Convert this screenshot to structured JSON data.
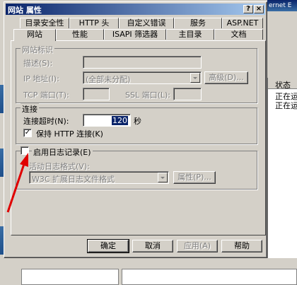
{
  "background": {
    "title_fragment": "ernet E",
    "list_header": "状态",
    "list_rows": [
      "正在运",
      "正在运"
    ]
  },
  "dialog": {
    "title": "网站 属性",
    "help_btn": "?",
    "close_btn": "×",
    "tabs_row1": [
      "目录安全性",
      "HTTP 头",
      "自定义错误",
      "服务",
      "ASP.NET"
    ],
    "tabs_row2": [
      "网站",
      "性能",
      "ISAPI 筛选器",
      "主目录",
      "文档"
    ]
  },
  "site_id": {
    "group_title": "网站标识",
    "desc_label": "描述(S):",
    "ip_label": "IP 地址(I):",
    "ip_value": "(全部未分配)",
    "advanced_btn": "高级(D)...",
    "tcp_label": "TCP 端口(T):",
    "ssl_label": "SSL 端口(L):"
  },
  "connection": {
    "group_title": "连接",
    "timeout_label": "连接超时(N):",
    "timeout_value": "120",
    "timeout_unit": "秒",
    "keepalive_label": "保持 HTTP 连接(K)",
    "keepalive_checked": "✓"
  },
  "logging": {
    "enable_label": "启用日志记录(E)",
    "format_label": "活动日志格式(V):",
    "format_value": "W3C 扩展日志文件格式",
    "props_btn": "属性(P)..."
  },
  "buttons": {
    "ok": "确定",
    "cancel": "取消",
    "apply": "应用(A)",
    "help": "帮助"
  },
  "colors": {
    "annotation_arrow": "#e00000",
    "title_gradient_start": "#0a246a"
  }
}
